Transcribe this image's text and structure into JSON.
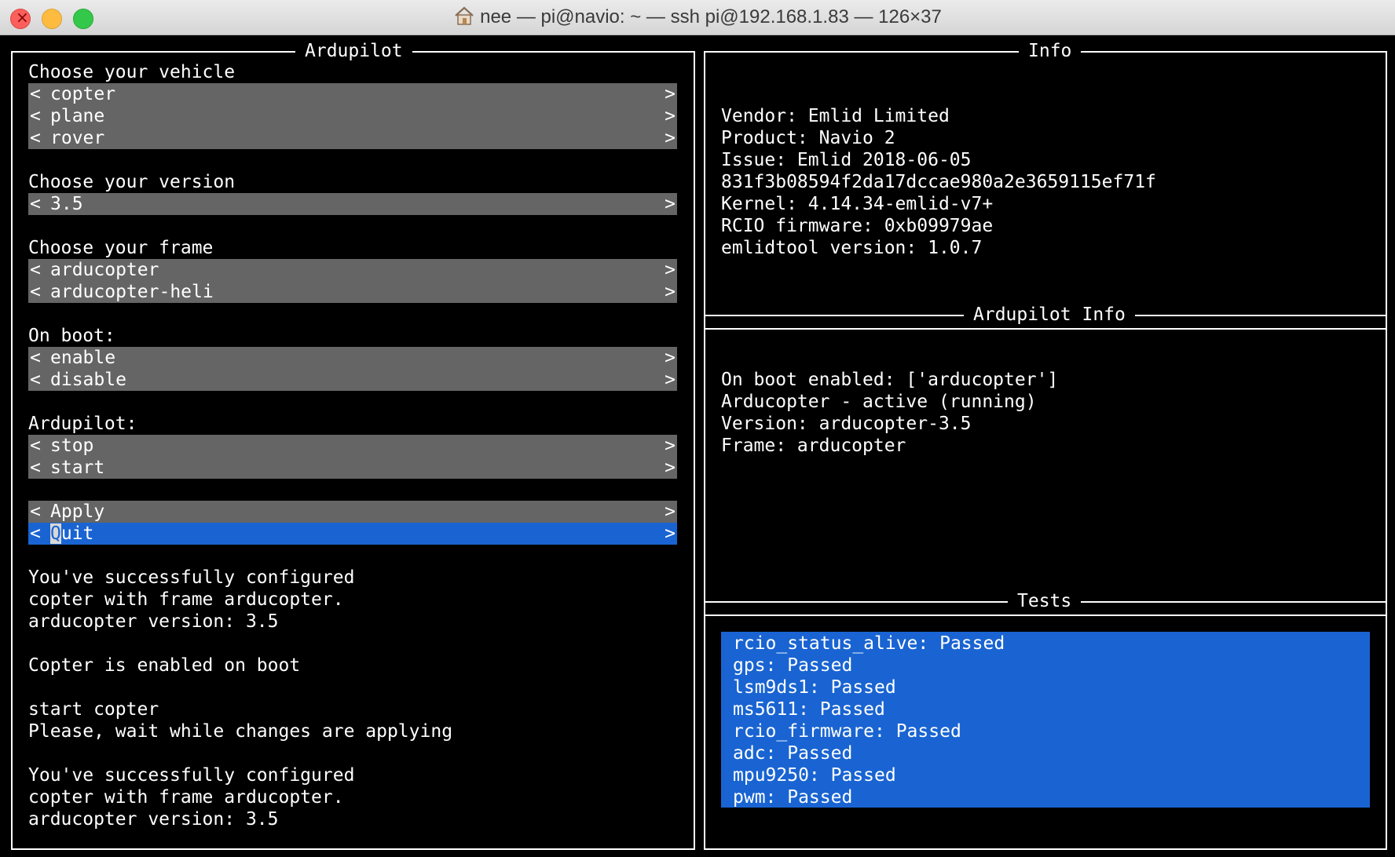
{
  "window": {
    "title": "nee — pi@navio: ~ — ssh pi@192.168.1.83 — 126×37"
  },
  "left": {
    "title": "Ardupilot",
    "vehicle": {
      "heading": "Choose your vehicle",
      "options": [
        "copter",
        "plane",
        "rover"
      ]
    },
    "version": {
      "heading": "Choose your version",
      "options": [
        "3.5"
      ]
    },
    "frame": {
      "heading": "Choose your frame",
      "options": [
        "arducopter",
        "arducopter-heli"
      ]
    },
    "boot": {
      "heading": "On boot:",
      "options": [
        "enable",
        "disable"
      ]
    },
    "ardupilot": {
      "heading": "Ardupilot:",
      "options": [
        "stop",
        "start"
      ]
    },
    "actions": {
      "apply": "Apply",
      "quit_first": "Q",
      "quit_rest": "uit"
    },
    "arrows": {
      "left": "<",
      "right": ">"
    },
    "log": [
      "You've successfully configured",
      "copter with frame arducopter.",
      "arducopter version: 3.5",
      "Copter is enabled on boot",
      "start copter",
      "Please, wait while changes are applying",
      "You've successfully configured",
      "copter with frame arducopter.",
      "arducopter version: 3.5"
    ]
  },
  "info": {
    "title": "Info",
    "lines": [
      "Vendor: Emlid Limited",
      "Product: Navio 2",
      "Issue: Emlid 2018-06-05",
      "831f3b08594f2da17dccae980a2e3659115ef71f",
      "Kernel: 4.14.34-emlid-v7+",
      "RCIO firmware: 0xb09979ae",
      "emlidtool version: 1.0.7"
    ]
  },
  "ardupilot_info": {
    "title": "Ardupilot Info",
    "lines": [
      "On boot enabled: ['arducopter']",
      "Arducopter - active (running)",
      "Version: arducopter-3.5",
      "Frame: arducopter"
    ]
  },
  "tests": {
    "title": "Tests",
    "lines": [
      "rcio_status_alive: Passed",
      "gps: Passed",
      "lsm9ds1: Passed",
      "ms5611: Passed",
      "rcio_firmware: Passed",
      "adc: Passed",
      "mpu9250: Passed",
      "pwm: Passed"
    ]
  },
  "colors": {
    "background": "#000000",
    "option_bg": "#656565",
    "selected_bg": "#1964d2",
    "text": "#ffffff"
  }
}
